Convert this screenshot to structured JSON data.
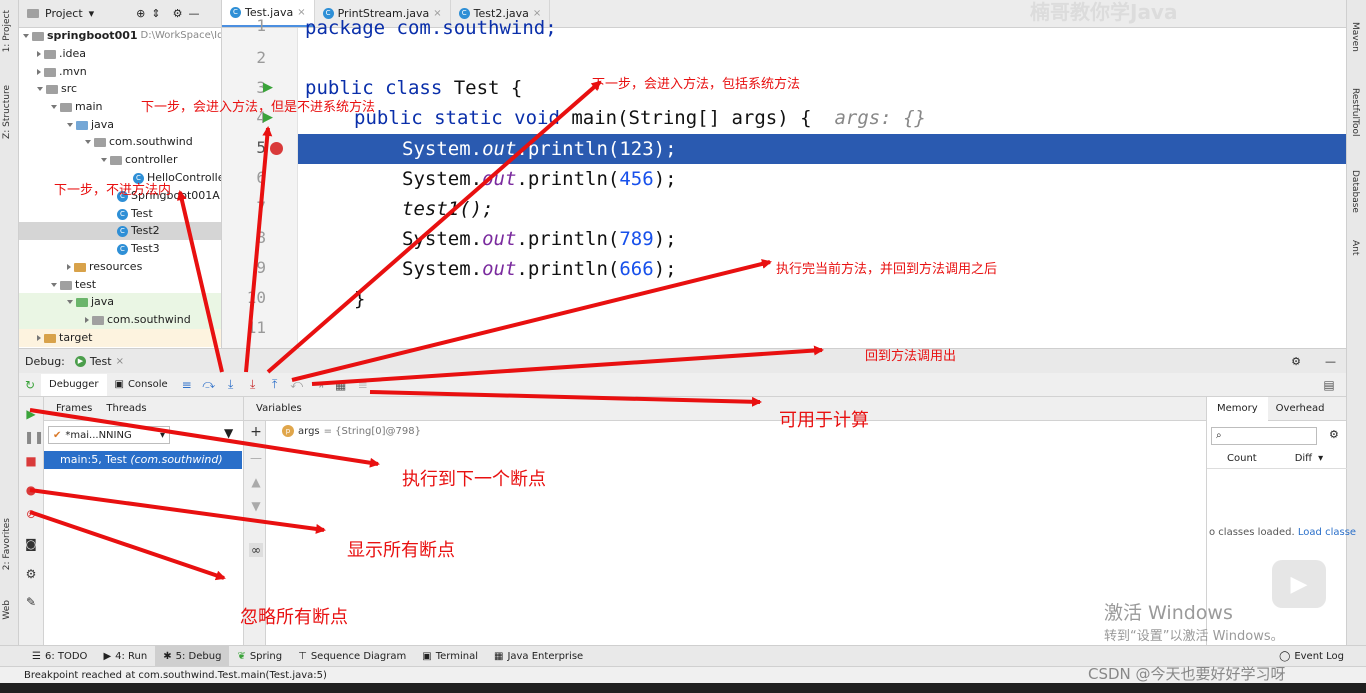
{
  "colors": {
    "accent": "#2a5ab0",
    "annotation": "#e81010",
    "selection": "#2a6fc9"
  },
  "left_strip": {
    "project_tab": "1: Project",
    "structure_tab": "Z: Structure",
    "favorites_tab": "2: Favorites",
    "web_tab": "Web"
  },
  "project": {
    "header": "Project",
    "root_name": "springboot001",
    "root_path": "D:\\WorkSpace\\Id",
    "items": [
      ".idea",
      ".mvn",
      "src",
      "main",
      "java",
      "com.southwind",
      "controller",
      "HelloControlle",
      "Springboot001A",
      "Test",
      "Test2",
      "Test3",
      "resources",
      "test",
      "java",
      "com.southwind",
      "target"
    ]
  },
  "tabs": [
    {
      "label": "Test.java"
    },
    {
      "label": "PrintStream.java"
    },
    {
      "label": "Test2.java"
    }
  ],
  "watermark_top": "楠哥教你学Java",
  "editor": {
    "line_numbers": [
      "1",
      "2",
      "3",
      "4",
      "5",
      "6",
      "7",
      "8",
      "9",
      "10",
      "11"
    ],
    "line1": "package com.southwind;",
    "line3_kw": "public class",
    "line3_rest": " Test {",
    "line4_kw": "public static void",
    "line4_rest": " main(String[] args) {",
    "line4_hint": "args: {}",
    "line5_a": "System.",
    "line5_b": "out",
    "line5_c": ".println(123);",
    "line6_a": "System.",
    "line6_b": "out",
    "line6_c": ".println(",
    "line6_num": "456",
    "line6_d": ");",
    "line7": "test1();",
    "line8_a": "System.",
    "line8_b": "out",
    "line8_c": ".println(",
    "line8_num": "789",
    "line8_d": ");",
    "line9_a": "System.",
    "line9_b": "out",
    "line9_c": ".println(",
    "line9_num": "666",
    "line9_d": ");",
    "line10": "}"
  },
  "right_strip": {
    "maven": "Maven",
    "restful": "RestfulTool",
    "database": "Database",
    "ant": "Ant"
  },
  "debug": {
    "label": "Debug:",
    "session_tab": "Test",
    "tabs": {
      "debugger": "Debugger",
      "console": "Console"
    },
    "frames_tab": "Frames",
    "threads_tab": "Threads",
    "thread_select": "*mai...NNING",
    "frame_row_text": "main:5, Test ",
    "frame_row_pkg": "(com.southwind)",
    "variables_header": "Variables",
    "var_name": "args",
    "var_value": " = {String[0]@798}",
    "memory_tab": "Memory",
    "overhead_tab": "Overhead",
    "count_col": "Count",
    "diff_col": "Diff",
    "memory_msg_a": "o classes loaded. ",
    "memory_msg_b": "Load classe"
  },
  "bottom": {
    "todo": "6: TODO",
    "run": "4: Run",
    "debug": "5: Debug",
    "spring": "Spring",
    "sequence": "Sequence Diagram",
    "terminal": "Terminal",
    "java_enterprise": "Java Enterprise",
    "event_log": "Event Log"
  },
  "status": "Breakpoint reached at com.southwind.Test.main(Test.java:5)",
  "annotations": {
    "step_over_into": "下一步，会进入方法，但是不进系统方法",
    "force_step_into": "下一步，会进入方法，包括系统方法",
    "step_over": "下一步，不进方法内",
    "step_out": "执行完当前方法，并回到方法调用之后",
    "drop_frame": "回到方法调用出",
    "evaluate": "可用于计算",
    "resume": "执行到下一个断点",
    "view_breakpoints": "显示所有断点",
    "mute_breakpoints": "忽略所有断点"
  },
  "windows_watermark": {
    "line1": "激活 Windows",
    "line2": "转到“设置”以激活 Windows。"
  },
  "csdn_watermark": "CSDN @今天也要好好学习呀"
}
